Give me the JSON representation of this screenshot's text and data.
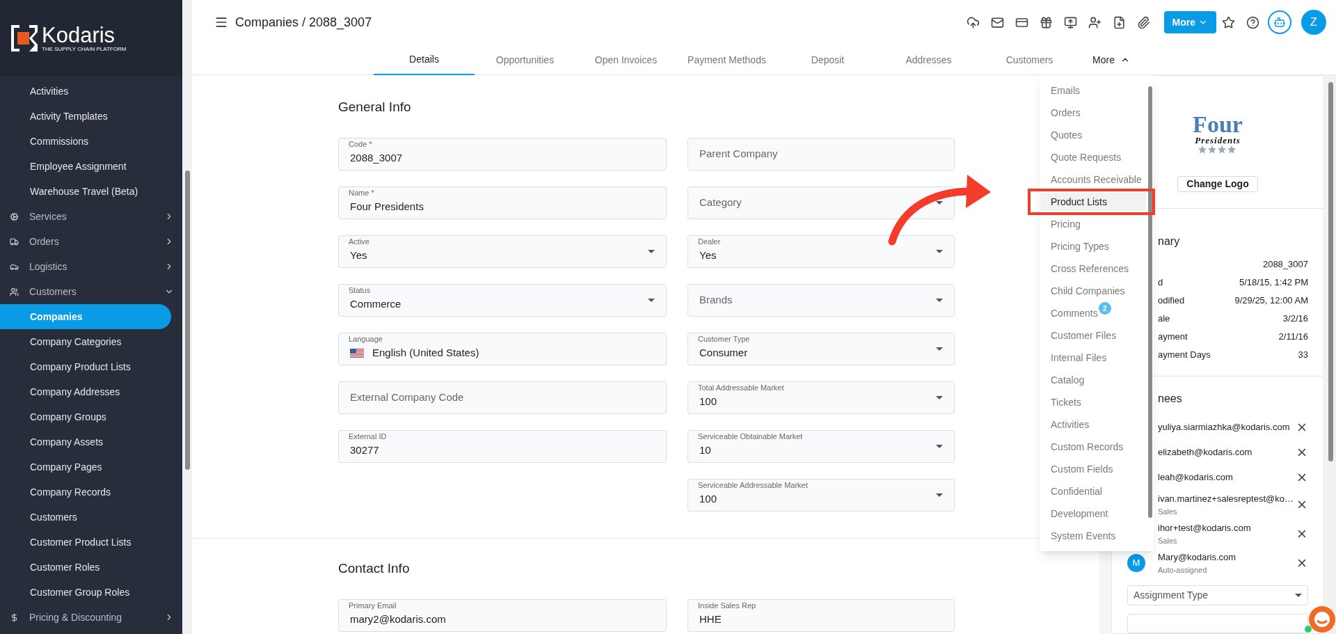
{
  "sidebar": {
    "logo": {
      "name": "Kodaris",
      "tagline": "THE SUPPLY CHAIN PLATFORM"
    },
    "items": [
      {
        "label": "Activities",
        "kind": "link",
        "selected": false
      },
      {
        "label": "Activity Templates",
        "kind": "link",
        "selected": false
      },
      {
        "label": "Commissions",
        "kind": "link",
        "selected": false
      },
      {
        "label": "Employee Assignment",
        "kind": "link",
        "selected": false
      },
      {
        "label": "Warehouse Travel (Beta)",
        "kind": "link",
        "selected": false
      },
      {
        "label": "Services",
        "kind": "group",
        "expanded": false,
        "selected": false
      },
      {
        "label": "Orders",
        "kind": "group",
        "expanded": false,
        "selected": false
      },
      {
        "label": "Logistics",
        "kind": "group",
        "expanded": false,
        "selected": false
      },
      {
        "label": "Customers",
        "kind": "group",
        "expanded": true,
        "selected": false
      },
      {
        "label": "Companies",
        "kind": "link",
        "selected": true
      },
      {
        "label": "Company Categories",
        "kind": "link",
        "selected": false
      },
      {
        "label": "Company Product Lists",
        "kind": "link",
        "selected": false
      },
      {
        "label": "Company Addresses",
        "kind": "link",
        "selected": false
      },
      {
        "label": "Company Groups",
        "kind": "link",
        "selected": false
      },
      {
        "label": "Company Assets",
        "kind": "link",
        "selected": false
      },
      {
        "label": "Company Pages",
        "kind": "link",
        "selected": false
      },
      {
        "label": "Company Records",
        "kind": "link",
        "selected": false
      },
      {
        "label": "Customers",
        "kind": "link",
        "selected": false
      },
      {
        "label": "Customer Product Lists",
        "kind": "link",
        "selected": false
      },
      {
        "label": "Customer Roles",
        "kind": "link",
        "selected": false
      },
      {
        "label": "Customer Group Roles",
        "kind": "link",
        "selected": false
      },
      {
        "label": "Pricing & Discounting",
        "kind": "group",
        "expanded": false,
        "selected": false
      }
    ]
  },
  "header": {
    "title": "Companies / 2088_3007",
    "more_button": "More",
    "avatar": "Z"
  },
  "tabs": [
    {
      "label": "Details",
      "selected": true
    },
    {
      "label": "Opportunities",
      "selected": false
    },
    {
      "label": "Open Invoices",
      "selected": false
    },
    {
      "label": "Payment Methods",
      "selected": false
    },
    {
      "label": "Deposit",
      "selected": false
    },
    {
      "label": "Addresses",
      "selected": false
    },
    {
      "label": "Customers",
      "selected": false
    }
  ],
  "more_tab": {
    "label": "More",
    "expanded": true
  },
  "more_menu": [
    {
      "label": "Emails",
      "selected": false
    },
    {
      "label": "Orders",
      "selected": false
    },
    {
      "label": "Quotes",
      "selected": false
    },
    {
      "label": "Quote Requests",
      "selected": false
    },
    {
      "label": "Accounts Receivable",
      "selected": false
    },
    {
      "label": "Product Lists",
      "selected": true
    },
    {
      "label": "Pricing",
      "selected": false
    },
    {
      "label": "Pricing Types",
      "selected": false
    },
    {
      "label": "Cross References",
      "selected": false
    },
    {
      "label": "Child Companies",
      "selected": false
    },
    {
      "label": "Comments",
      "selected": false,
      "badge": "2"
    },
    {
      "label": "Customer Files",
      "selected": false
    },
    {
      "label": "Internal Files",
      "selected": false
    },
    {
      "label": "Catalog",
      "selected": false
    },
    {
      "label": "Tickets",
      "selected": false
    },
    {
      "label": "Activities",
      "selected": false
    },
    {
      "label": "Custom Records",
      "selected": false
    },
    {
      "label": "Custom Fields",
      "selected": false
    },
    {
      "label": "Confidential",
      "selected": false
    },
    {
      "label": "Development",
      "selected": false
    },
    {
      "label": "System Events",
      "selected": false
    }
  ],
  "general_info": {
    "title": "General Info",
    "left": [
      {
        "kind": "text",
        "label": "Code *",
        "value": "2088_3007"
      },
      {
        "kind": "text",
        "label": "Name *",
        "value": "Four Presidents"
      },
      {
        "kind": "select",
        "label": "Active",
        "value": "Yes"
      },
      {
        "kind": "select",
        "label": "Status",
        "value": "Commerce"
      },
      {
        "kind": "language",
        "label": "Language",
        "value": "English (United States)"
      },
      {
        "kind": "text",
        "placeholder": "External Company Code"
      },
      {
        "kind": "text",
        "label": "External ID",
        "value": "30277"
      }
    ],
    "right": [
      {
        "kind": "text",
        "placeholder": "Parent Company"
      },
      {
        "kind": "select",
        "placeholder": "Category"
      },
      {
        "kind": "select",
        "label": "Dealer",
        "value": "Yes"
      },
      {
        "kind": "select",
        "placeholder": "Brands"
      },
      {
        "kind": "select",
        "label": "Customer Type",
        "value": "Consumer"
      },
      {
        "kind": "select",
        "label": "Total Addressable Market",
        "value": "100"
      },
      {
        "kind": "select",
        "label": "Serviceable Obtainable Market",
        "value": "10"
      },
      {
        "kind": "select",
        "label": "Serviceable Addressable Market",
        "value": "100"
      }
    ]
  },
  "contact_info": {
    "title": "Contact Info",
    "left": [
      {
        "kind": "text",
        "label": "Primary Email",
        "value": "mary2@kodaris.com"
      }
    ],
    "right": [
      {
        "kind": "text",
        "label": "Inside Sales Rep",
        "value": "HHE"
      }
    ]
  },
  "company_panel": {
    "logo": {
      "line1": "Four",
      "line2": "Presidents"
    },
    "change_logo": "Change Logo",
    "summary": {
      "title": "nary",
      "rows": [
        {
          "value": "2088_3007"
        },
        {
          "label": "d",
          "value": "5/18/15, 1:42 PM"
        },
        {
          "label": "odified",
          "value": "9/29/25, 12:00 AM"
        },
        {
          "label": "ale",
          "value": "3/2/16"
        },
        {
          "label": "ayment",
          "value": "2/11/16"
        },
        {
          "label": "ayment Days",
          "value": "33"
        }
      ]
    },
    "assignees": {
      "title": "nees",
      "items": [
        {
          "email": "yuliya.siarmiazhka@kodaris.com"
        },
        {
          "email": "elizabeth@kodaris.com"
        },
        {
          "email": "leah@kodaris.com"
        },
        {
          "email": "ivan.martinez+salesreptest@ko…",
          "role": "Sales"
        },
        {
          "email": "ihor+test@kodaris.com",
          "role": "Sales"
        },
        {
          "email": "Mary@kodaris.com",
          "role": "Auto-assigned",
          "avatar": "M"
        }
      ]
    },
    "assignment_type": {
      "placeholder": "Assignment Type"
    }
  }
}
